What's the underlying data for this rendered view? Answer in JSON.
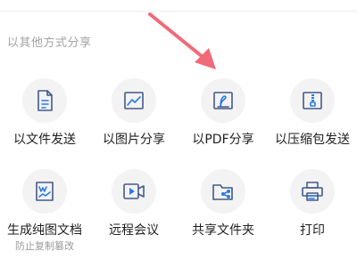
{
  "section_title": "以其他方式分享",
  "share_items": [
    {
      "label": "以文件发送",
      "icon": "document-icon"
    },
    {
      "label": "以图片分享",
      "icon": "image-icon"
    },
    {
      "label": "以PDF分享",
      "icon": "pdf-icon"
    },
    {
      "label": "以压缩包发送",
      "icon": "zip-icon"
    },
    {
      "label": "生成纯图文档",
      "sublabel": "防止复制篡改",
      "icon": "image-doc-icon"
    },
    {
      "label": "远程会议",
      "icon": "video-meeting-icon"
    },
    {
      "label": "共享文件夹",
      "icon": "shared-folder-icon"
    },
    {
      "label": "打印",
      "icon": "printer-icon"
    }
  ],
  "colors": {
    "icon_stroke": "#455a8a",
    "icon_accent": "#2a7be4",
    "arrow": "#f06a78"
  }
}
